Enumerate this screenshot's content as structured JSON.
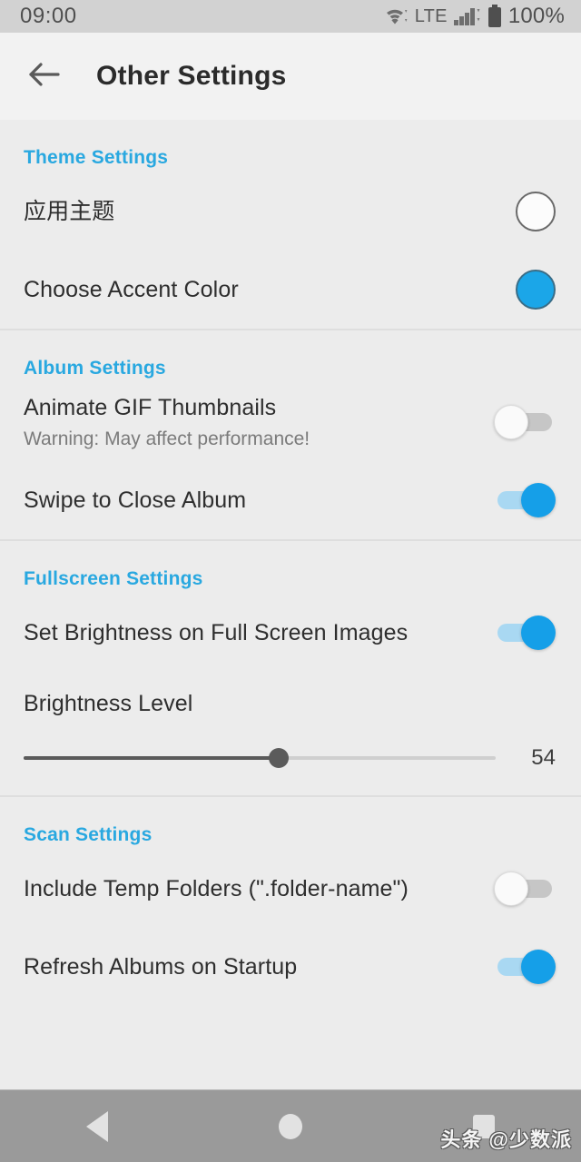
{
  "status_bar": {
    "time": "09:00",
    "network_label": "LTE",
    "battery_label": "100%",
    "icons": [
      "wifi-icon",
      "signal-icon",
      "battery-icon"
    ]
  },
  "app_bar": {
    "back_icon": "arrow-left-icon",
    "title": "Other Settings"
  },
  "theme": {
    "accent_color": "#1ba6e8",
    "header_color": "#29a8e0"
  },
  "sections": [
    {
      "header": "Theme Settings",
      "rows": [
        {
          "title": "应用主题",
          "subtitle": "",
          "control": "swatch",
          "state": "empty",
          "name": "app-theme"
        },
        {
          "title": "Choose Accent Color",
          "subtitle": "",
          "control": "swatch",
          "state": "filled",
          "name": "choose-accent-color"
        }
      ]
    },
    {
      "header": "Album Settings",
      "rows": [
        {
          "title": "Animate GIF Thumbnails",
          "subtitle": "Warning: May affect performance!",
          "control": "toggle",
          "state": "off",
          "name": "animate-gif-thumbnails"
        },
        {
          "title": "Swipe to Close Album",
          "subtitle": "",
          "control": "toggle",
          "state": "on",
          "name": "swipe-to-close-album"
        }
      ]
    },
    {
      "header": "Fullscreen Settings",
      "rows": [
        {
          "title": "Set Brightness on Full Screen Images",
          "subtitle": "",
          "control": "toggle",
          "state": "on",
          "name": "set-brightness-fullscreen"
        },
        {
          "title": "Brightness Level",
          "subtitle": "",
          "control": "none",
          "state": "",
          "name": "brightness-level"
        }
      ],
      "slider": {
        "value": "54",
        "percent": 54,
        "min": 0,
        "max": 100
      }
    },
    {
      "header": "Scan Settings",
      "rows": [
        {
          "title": "Include Temp Folders (\".folder-name\")",
          "subtitle": "",
          "control": "toggle",
          "state": "off",
          "name": "include-temp-folders"
        },
        {
          "title": "Refresh Albums on Startup",
          "subtitle": "",
          "control": "toggle",
          "state": "on",
          "name": "refresh-albums-on-startup"
        }
      ]
    }
  ],
  "nav_bar": {
    "back_icon": "triangle-back-icon",
    "home_icon": "circle-home-icon",
    "recents_icon": "square-recents-icon",
    "watermark": "头条 @少数派"
  }
}
